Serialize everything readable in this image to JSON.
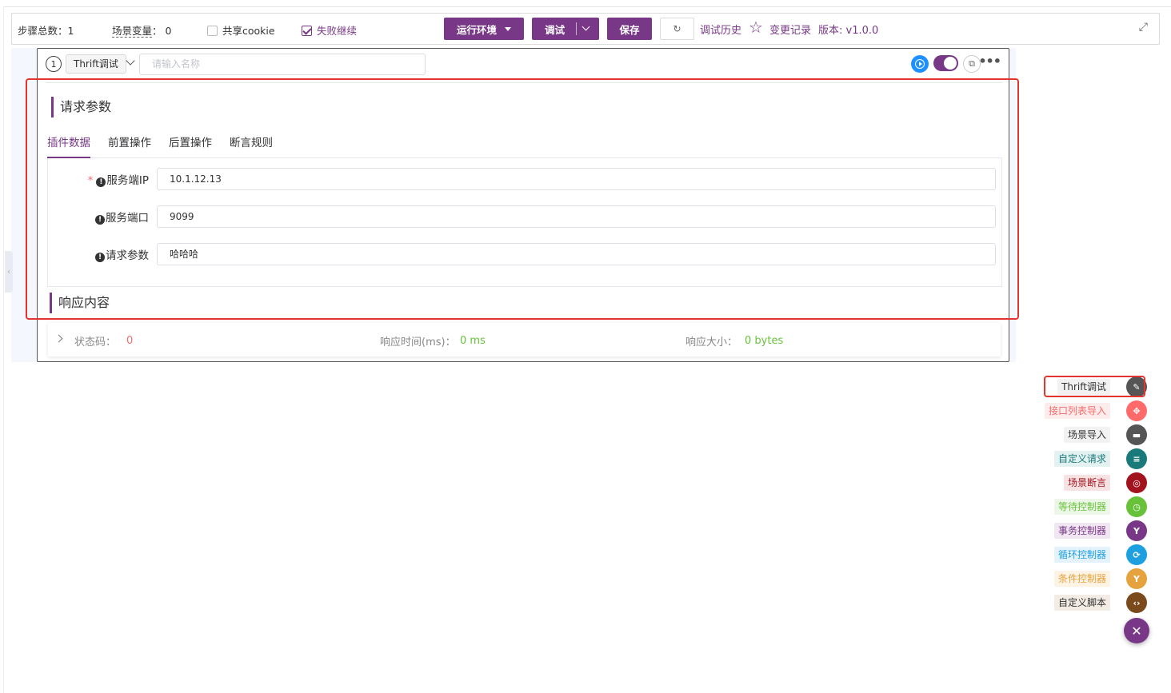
{
  "toolbar": {
    "step_total_label": "步骤总数：",
    "step_total_value": "1",
    "scene_var_label": "场景变量",
    "scene_var_colon": "：",
    "scene_var_value": "0",
    "share_cookie_label": "共享cookie",
    "share_cookie_checked": false,
    "fail_continue_label": "失败继续",
    "fail_continue_checked": true,
    "env_button": "运行环境",
    "debug_button": "调试",
    "save_button": "保存",
    "history_link": "调试历史",
    "changelog_link": "变更记录",
    "version_text": "版本: v1.0.0"
  },
  "step": {
    "index": "1",
    "tag": "Thrift调试",
    "name_placeholder": "请输入名称",
    "enabled": true
  },
  "request": {
    "title": "请求参数",
    "tabs": [
      "插件数据",
      "前置操作",
      "后置操作",
      "断言规则"
    ],
    "active_tab": "插件数据",
    "fields": [
      {
        "label": "服务端IP",
        "required": true,
        "value": "10.1.12.13"
      },
      {
        "label": "服务端口",
        "required": false,
        "value": "9099"
      },
      {
        "label": "请求参数",
        "required": false,
        "value": "哈哈哈"
      }
    ]
  },
  "response": {
    "title": "响应内容",
    "status_label": "状态码：",
    "status_value": "0",
    "time_label": "响应时间(ms)：",
    "time_value": "0 ms",
    "size_label": "响应大小：",
    "size_value": "0 bytes"
  },
  "float_menu": {
    "items": [
      {
        "label": "Thrift调试",
        "icon": "pencil-icon",
        "color": "#555555",
        "label_color": "#333333",
        "label_bg": "#f2f2f2"
      },
      {
        "label": "接口列表导入",
        "icon": "move-icon",
        "color": "#ff6b6b",
        "label_color": "#f56c6c",
        "label_bg": "#fdecec"
      },
      {
        "label": "场景导入",
        "icon": "clapper-icon",
        "color": "#555555",
        "label_color": "#333333",
        "label_bg": "#f2f2f2"
      },
      {
        "label": "自定义请求",
        "icon": "sliders-icon",
        "color": "#1a7a7a",
        "label_color": "#1a7a7a",
        "label_bg": "#e3f1f1"
      },
      {
        "label": "场景断言",
        "icon": "assert-icon",
        "color": "#a3131e",
        "label_color": "#a3131e",
        "label_bg": "#f6e2e3"
      },
      {
        "label": "等待控制器",
        "icon": "clock-icon",
        "color": "#67c23a",
        "label_color": "#67c23a",
        "label_bg": "#edf7e7"
      },
      {
        "label": "事务控制器",
        "icon": "fork-icon",
        "color": "#783887",
        "label_color": "#783887",
        "label_bg": "#f1e7f3"
      },
      {
        "label": "循环控制器",
        "icon": "loop-icon",
        "color": "#1e9fe0",
        "label_color": "#1e9fe0",
        "label_bg": "#e4f3fb"
      },
      {
        "label": "条件控制器",
        "icon": "branch-icon",
        "color": "#e6a23c",
        "label_color": "#e6a23c",
        "label_bg": "#fcf3e4"
      },
      {
        "label": "自定义脚本",
        "icon": "code-icon",
        "color": "#7a4a1c",
        "label_color": "#333333",
        "label_bg": "#f3ece4"
      }
    ]
  }
}
